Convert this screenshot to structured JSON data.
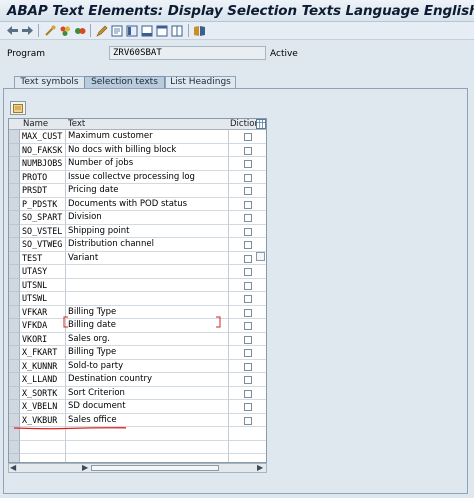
{
  "window": {
    "title": "ABAP Text Elements: Display Selection Texts Language English"
  },
  "toolbar": {
    "icons": [
      "back-icon",
      "forward-icon",
      "other-object-icon",
      "check-icon",
      "activate-icon",
      "display-change-icon",
      "where-used-icon",
      "object-list-icon",
      "navigation-window-icon",
      "window-icon",
      "split-icon",
      "help-icon"
    ]
  },
  "program": {
    "label": "Program",
    "value": "ZRV60SBAT",
    "status": "Active"
  },
  "tabs": [
    {
      "label": "Text symbols"
    },
    {
      "label": "Selection texts"
    },
    {
      "label": "List Headings"
    }
  ],
  "grid": {
    "columns": {
      "name": "Name",
      "text": "Text",
      "dict": "Diction..."
    },
    "rows": [
      {
        "name": "MAX_CUST",
        "text": "Maximum customer"
      },
      {
        "name": "NO_FAKSK",
        "text": "No docs with billing block"
      },
      {
        "name": "NUMBJOBS",
        "text": "Number of jobs"
      },
      {
        "name": "PROTO",
        "text": "Issue collectve processing log"
      },
      {
        "name": "PRSDT",
        "text": "Pricing date"
      },
      {
        "name": "P_PDSTK",
        "text": "Documents with POD status"
      },
      {
        "name": "SO_SPART",
        "text": "Division"
      },
      {
        "name": "SO_VSTEL",
        "text": "Shipping point"
      },
      {
        "name": "SO_VTWEG",
        "text": "Distribution channel"
      },
      {
        "name": "TEST",
        "text": "Variant"
      },
      {
        "name": "UTASY",
        "text": ""
      },
      {
        "name": "UTSNL",
        "text": ""
      },
      {
        "name": "UTSWL",
        "text": ""
      },
      {
        "name": "VFKAR",
        "text": "Billing Type"
      },
      {
        "name": "VFKDA",
        "text": "Billing date"
      },
      {
        "name": "VKORI",
        "text": "Sales org."
      },
      {
        "name": "X_FKART",
        "text": "Billing Type"
      },
      {
        "name": "X_KUNNR",
        "text": "Sold-to party"
      },
      {
        "name": "X_LLAND",
        "text": "Destination country"
      },
      {
        "name": "X_SORTK",
        "text": "Sort Criterion"
      },
      {
        "name": "X_VBELN",
        "text": "SD document"
      },
      {
        "name": "X_VKBUR",
        "text": "Sales office"
      },
      {
        "name": "",
        "text": ""
      },
      {
        "name": "",
        "text": ""
      },
      {
        "name": "",
        "text": ""
      },
      {
        "name": "",
        "text": ""
      }
    ]
  },
  "colors": {
    "background": "#dfe7ef",
    "title": "#0d1c33",
    "annotation": "#e0201c",
    "active_tab": "#b9cbdc"
  }
}
